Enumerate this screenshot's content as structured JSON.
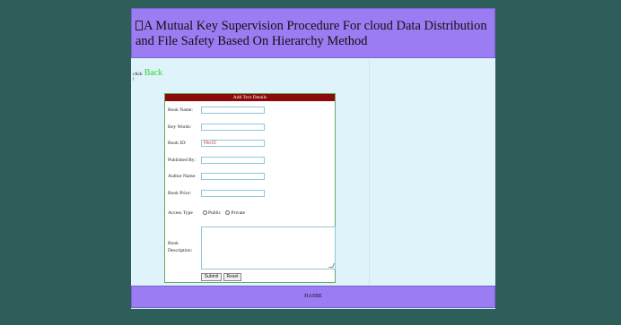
{
  "header": {
    "title": "A Mutual Key Supervision Procedure For cloud Data Distribution and File Safety Based On Hierarchy Method"
  },
  "nav": {
    "prefix": "click",
    "back_label": "Back",
    "bang": "!"
  },
  "form": {
    "heading": "Add Text Details",
    "fields": {
      "book_name": {
        "label": "Book Name:",
        "value": ""
      },
      "key_words": {
        "label": "Key Words:",
        "value": ""
      },
      "book_id": {
        "label": "Book ID:",
        "value": "File10"
      },
      "published_by": {
        "label": "Published By:",
        "value": ""
      },
      "author_name": {
        "label": "Author Name:",
        "value": ""
      },
      "book_price": {
        "label": "Book Price:",
        "value": ""
      }
    },
    "access_type": {
      "label": "Access Type",
      "options": [
        "Public",
        "Private"
      ]
    },
    "description": {
      "label_line1": "Book",
      "label_line2": "Description:",
      "value": ""
    },
    "submit_label": "Submit",
    "reset_label": "Reset"
  },
  "footer": {
    "text": "HASBE"
  },
  "colors": {
    "background": "#2e5e5a",
    "header": "#9b7cf2",
    "content": "#dff3fb",
    "form_head": "#8c0a0a",
    "back_link": "#2fd42f"
  }
}
